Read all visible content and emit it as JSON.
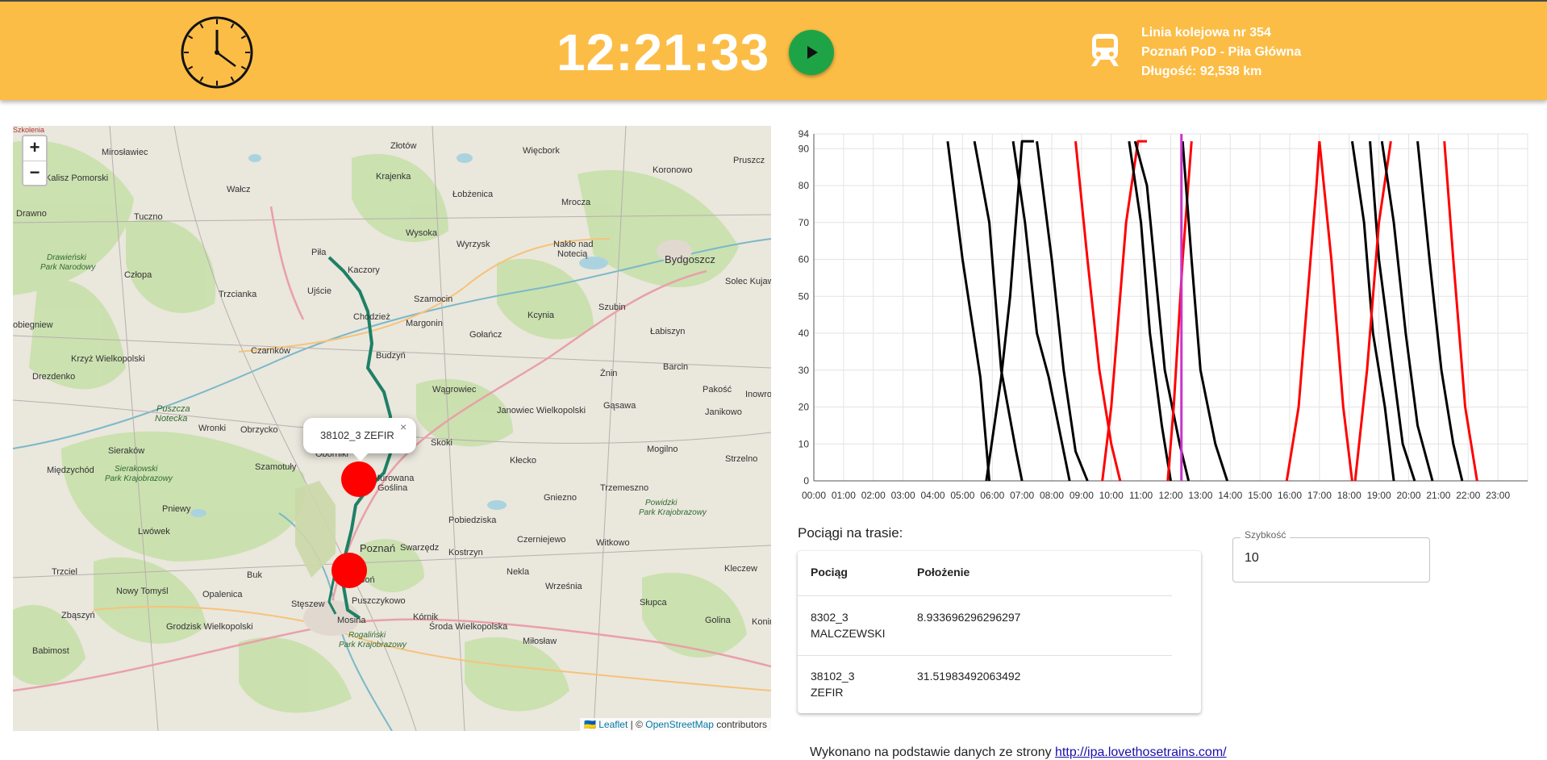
{
  "header": {
    "time": "12:21:33",
    "route_line": "Linia kolejowa nr 354",
    "route_name": "Poznań PoD - Piła Główna",
    "route_length": "Długość: 92,538 km",
    "bg_color": "#fcbd46",
    "icons": {
      "clock": "analog-clock-icon",
      "play": "play-icon",
      "train": "train-icon"
    }
  },
  "map": {
    "zoom_in": "+",
    "zoom_out": "−",
    "popup_text": "38102_3 ZEFIR",
    "popup_close": "×",
    "attribution": {
      "flag": "🇺🇦",
      "leaflet": "Leaflet",
      "sep": " | © ",
      "osm": "OpenStreetMap",
      "suffix": " contributors"
    },
    "places": [
      "Szkolenia",
      "Mirosławiec",
      "Złotów",
      "Więcbork",
      "Pruszcz",
      "Kalisz Pomorski",
      "Wałcz",
      "Krajenka",
      "Koronowo",
      "Łobżenica",
      "Mrocza",
      "Drawno",
      "Tuczno",
      "Wysoka",
      "Wyrzysk",
      "Nakło nad Notecią",
      "Bydgoszcz",
      "Drawieński Park Narodowy",
      "Piła",
      "Kaczory",
      "Solec Kujawski",
      "Człopa",
      "Ujście",
      "Trzcianka",
      "Chodzież",
      "Szamocin",
      "Kcynia",
      "Szubin",
      "Margonin",
      "Gołańcz",
      "Łabiszyn",
      "Dobiegniew",
      "Czarnków",
      "Budzyń",
      "Krzyż Wielkopolski",
      "Barcin",
      "Drezdenko",
      "Żnin",
      "Pakość",
      "Wągrowiec",
      "Inowrocław",
      "Puszcza Notecka",
      "Gąsawa",
      "Janowiec Wielkopolski",
      "Janikowo",
      "Wronki",
      "Obrzycko",
      "Skoki",
      "Sieraków",
      "Mogilno",
      "Sierakowski Park Krajobrazowy",
      "Kłecko",
      "Strzelno",
      "Oborniki",
      "Międzychód",
      "Szamotuły",
      "Murowana Goślina",
      "Trzemeszno",
      "Gniezno",
      "Pniewy",
      "Powidzki Park Krajobrazowy",
      "Pobiedziska",
      "Lwówek",
      "Czerniejewo",
      "Witkowo",
      "Swarzędz",
      "Poznań",
      "Kostrzyn",
      "Trzciel",
      "Buk",
      "Nekla",
      "Kleczew",
      "Luboń",
      "Września",
      "Nowy Tomyśl",
      "Opalenica",
      "Słupca",
      "Stęszew",
      "Puszczykowo",
      "Zbąszyń",
      "Mosina",
      "Kórnik",
      "Golina",
      "Grodzisk Wielkopolski",
      "Środa Wielkopolska",
      "Rogaliński Park Krajobrazowy",
      "Babimost",
      "Miłosław",
      "Konin"
    ]
  },
  "chart_data": {
    "type": "line",
    "title": "",
    "xlabel": "",
    "ylabel": "",
    "xlim": [
      0,
      24
    ],
    "ylim": [
      0,
      94
    ],
    "x_tick_labels": [
      "00:00",
      "01:00",
      "02:00",
      "03:00",
      "04:00",
      "05:00",
      "06:00",
      "07:00",
      "08:00",
      "09:00",
      "10:00",
      "11:00",
      "12:00",
      "13:00",
      "14:00",
      "15:00",
      "16:00",
      "17:00",
      "18:00",
      "19:00",
      "20:00",
      "21:00",
      "22:00",
      "23:00"
    ],
    "y_ticks": [
      0,
      10,
      20,
      30,
      40,
      50,
      60,
      70,
      80,
      90,
      94
    ],
    "grid": true,
    "current_time_marker": {
      "x": 12.36,
      "color": "#cc33cc"
    },
    "series": [
      {
        "color": "#000000",
        "x": [
          4.5,
          5.0,
          5.6,
          5.9
        ],
        "y": [
          92,
          60,
          28,
          0
        ]
      },
      {
        "color": "#000000",
        "x": [
          5.4,
          5.9,
          6.3,
          6.8,
          7.0
        ],
        "y": [
          92,
          70,
          30,
          8,
          0
        ]
      },
      {
        "color": "#000000",
        "x": [
          5.8,
          6.3,
          6.6,
          7.0,
          7.4
        ],
        "y": [
          0,
          28,
          50,
          92,
          92
        ]
      },
      {
        "color": "#000000",
        "x": [
          6.7,
          7.1,
          7.5,
          7.9,
          8.6
        ],
        "y": [
          92,
          70,
          40,
          28,
          0
        ]
      },
      {
        "color": "#000000",
        "x": [
          7.5,
          8.0,
          8.4,
          8.8,
          9.2
        ],
        "y": [
          92,
          60,
          30,
          8,
          0
        ]
      },
      {
        "color": "#ff0000",
        "x": [
          8.8,
          9.2,
          9.6,
          10.0,
          10.3
        ],
        "y": [
          92,
          60,
          30,
          10,
          0
        ]
      },
      {
        "color": "#ff0000",
        "x": [
          9.7,
          10.0,
          10.5,
          10.9,
          11.2
        ],
        "y": [
          0,
          20,
          70,
          92,
          92
        ]
      },
      {
        "color": "#000000",
        "x": [
          10.6,
          11.0,
          11.3,
          11.7,
          12.0
        ],
        "y": [
          92,
          70,
          40,
          15,
          0
        ]
      },
      {
        "color": "#000000",
        "x": [
          10.8,
          11.2,
          11.8,
          12.3,
          12.6
        ],
        "y": [
          92,
          80,
          30,
          10,
          0
        ]
      },
      {
        "color": "#ff0000",
        "x": [
          11.9,
          12.1,
          12.4,
          12.7
        ],
        "y": [
          0,
          20,
          60,
          92
        ]
      },
      {
        "color": "#000000",
        "x": [
          12.4,
          12.7,
          13.0,
          13.5,
          13.9
        ],
        "y": [
          92,
          60,
          30,
          10,
          0
        ]
      },
      {
        "color": "#ff0000",
        "x": [
          15.9,
          16.3,
          16.6,
          16.9,
          17.0
        ],
        "y": [
          0,
          20,
          50,
          80,
          92
        ]
      },
      {
        "color": "#ff0000",
        "x": [
          17.0,
          17.4,
          17.8,
          18.1
        ],
        "y": [
          92,
          60,
          20,
          0
        ]
      },
      {
        "color": "#000000",
        "x": [
          18.1,
          18.5,
          18.8,
          19.2,
          19.5
        ],
        "y": [
          92,
          70,
          40,
          20,
          0
        ]
      },
      {
        "color": "#000000",
        "x": [
          18.7,
          19.0,
          19.4,
          19.8,
          20.2
        ],
        "y": [
          92,
          60,
          35,
          10,
          0
        ]
      },
      {
        "color": "#ff0000",
        "x": [
          18.2,
          18.6,
          19.0,
          19.4
        ],
        "y": [
          0,
          30,
          70,
          92
        ]
      },
      {
        "color": "#000000",
        "x": [
          19.1,
          19.5,
          19.9,
          20.3,
          20.8
        ],
        "y": [
          92,
          70,
          40,
          15,
          0
        ]
      },
      {
        "color": "#000000",
        "x": [
          20.3,
          20.7,
          21.1,
          21.5,
          21.8
        ],
        "y": [
          92,
          60,
          30,
          10,
          0
        ]
      },
      {
        "color": "#ff0000",
        "x": [
          21.2,
          21.5,
          21.9,
          22.3
        ],
        "y": [
          92,
          60,
          20,
          0
        ]
      }
    ]
  },
  "trains": {
    "title": "Pociągi na trasie:",
    "headers": [
      "Pociąg",
      "Położenie"
    ],
    "rows": [
      {
        "name_line1": "8302_3",
        "name_line2": "MALCZEWSKI",
        "position": "8.933696296296297"
      },
      {
        "name_line1": "38102_3",
        "name_line2": "ZEFIR",
        "position": "31.51983492063492"
      }
    ]
  },
  "speed": {
    "label": "Szybkość",
    "value": "10"
  },
  "footer": {
    "text": "Wykonano na podstawie danych ze strony ",
    "link": "http://ipa.lovethosetrains.com/"
  }
}
